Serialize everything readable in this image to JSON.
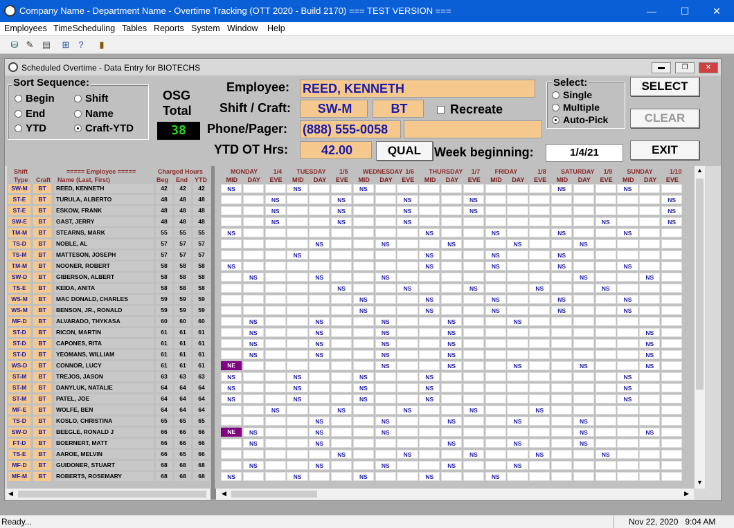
{
  "window": {
    "title": "Company Name - Department Name - Overtime Tracking (OTT 2020 - Build 2170) === TEST VERSION ===",
    "min": "—",
    "max": "☐",
    "close": "✕"
  },
  "menu": [
    "Employees",
    "TimeScheduling",
    "Tables",
    "Reports",
    "System",
    "Window",
    "Help"
  ],
  "toolbar_icons": [
    "database-icon",
    "pen-icon",
    "printer-icon",
    "grid-icon",
    "help-icon",
    "exit-door-icon"
  ],
  "child": {
    "title": "Scheduled Overtime - Data Entry for BIOTECHS"
  },
  "sort": {
    "label": "Sort Sequence:",
    "options": [
      {
        "label": "Begin",
        "selected": false
      },
      {
        "label": "Shift",
        "selected": false
      },
      {
        "label": "End",
        "selected": false
      },
      {
        "label": "Name",
        "selected": false
      },
      {
        "label": "YTD",
        "selected": false
      },
      {
        "label": "Craft-YTD",
        "selected": true
      }
    ]
  },
  "osg": {
    "label1": "OSG",
    "label2": "Total",
    "value": "38"
  },
  "employee": {
    "label": "Employee:",
    "value": "REED, KENNETH"
  },
  "shift_craft": {
    "label": "Shift / Craft:",
    "shift": "SW-M",
    "craft": "BT"
  },
  "recreate": {
    "label": "Recreate",
    "checked": false
  },
  "phone": {
    "label": "Phone/Pager:",
    "value": "(888) 555-0058",
    "value2": ""
  },
  "ytd": {
    "label": "YTD OT Hrs:",
    "value": "42.00"
  },
  "qual_button": "QUAL",
  "week": {
    "label": "Week beginning:",
    "value": "1/4/21"
  },
  "select": {
    "label": "Select:",
    "options": [
      {
        "label": "Single",
        "selected": false
      },
      {
        "label": "Multiple",
        "selected": false
      },
      {
        "label": "Auto-Pick",
        "selected": true
      }
    ]
  },
  "buttons": {
    "select": "SELECT",
    "clear": "CLEAR",
    "exit": "EXIT"
  },
  "grid_header": {
    "shift_type": "Shift\nType",
    "shift": "Shift",
    "type": "Type",
    "craft": "Craft",
    "employee": "===== Employee =====",
    "name": "Name (Last, First)",
    "charged": "Charged Hours",
    "beg": "Beg",
    "end": "End",
    "ytd": "YTD",
    "days": [
      {
        "day": "MONDAY",
        "date": "1/4"
      },
      {
        "day": "TUESDAY",
        "date": "1/5"
      },
      {
        "day": "WEDNESDAY",
        "date": "1/6"
      },
      {
        "day": "THURSDAY",
        "date": "1/7"
      },
      {
        "day": "FRIDAY",
        "date": "1/8"
      },
      {
        "day": "SATURDAY",
        "date": "1/9"
      },
      {
        "day": "SUNDAY",
        "date": "1/10"
      }
    ],
    "slots": [
      "MID",
      "DAY",
      "EVE"
    ]
  },
  "rows": [
    {
      "shift": "SW-M",
      "craft": "BT",
      "name": "REED, KENNETH",
      "beg": "42",
      "end": "42",
      "ytd": "42",
      "s": [
        "NS",
        "",
        "",
        "NS",
        "",
        "",
        "NS",
        "",
        "",
        "",
        "",
        "",
        "",
        "",
        "",
        "NS",
        "",
        "",
        "NS",
        "",
        ""
      ]
    },
    {
      "shift": "ST-E",
      "craft": "BT",
      "name": "TURULA, ALBERTO",
      "beg": "48",
      "end": "48",
      "ytd": "48",
      "s": [
        "",
        "",
        "NS",
        "",
        "",
        "NS",
        "",
        "",
        "NS",
        "",
        "",
        "NS",
        "",
        "",
        "",
        "",
        "",
        "",
        "",
        "",
        "NS"
      ]
    },
    {
      "shift": "ST-E",
      "craft": "BT",
      "name": "ESKOW, FRANK",
      "beg": "48",
      "end": "48",
      "ytd": "48",
      "s": [
        "",
        "",
        "NS",
        "",
        "",
        "NS",
        "",
        "",
        "NS",
        "",
        "",
        "NS",
        "",
        "",
        "",
        "",
        "",
        "",
        "",
        "",
        "NS"
      ]
    },
    {
      "shift": "SW-E",
      "craft": "BT",
      "name": "GAST, JERRY",
      "beg": "48",
      "end": "48",
      "ytd": "48",
      "s": [
        "",
        "",
        "NS",
        "",
        "",
        "NS",
        "",
        "",
        "NS",
        "",
        "",
        "",
        "",
        "",
        "",
        "",
        "",
        "NS",
        "",
        "",
        "NS"
      ]
    },
    {
      "shift": "TM-M",
      "craft": "BT",
      "name": "STEARNS, MARK",
      "beg": "55",
      "end": "55",
      "ytd": "55",
      "s": [
        "NS",
        "",
        "",
        "",
        "",
        "",
        "",
        "",
        "",
        "NS",
        "",
        "",
        "NS",
        "",
        "",
        "NS",
        "",
        "",
        "NS",
        "",
        ""
      ]
    },
    {
      "shift": "TS-D",
      "craft": "BT",
      "name": "NOBLE, AL",
      "beg": "57",
      "end": "57",
      "ytd": "57",
      "s": [
        "",
        "",
        "",
        "",
        "NS",
        "",
        "",
        "NS",
        "",
        "",
        "NS",
        "",
        "",
        "NS",
        "",
        "",
        "NS",
        "",
        "",
        "",
        ""
      ]
    },
    {
      "shift": "TS-M",
      "craft": "BT",
      "name": "MATTESON, JOSEPH",
      "beg": "57",
      "end": "57",
      "ytd": "57",
      "s": [
        "",
        "",
        "",
        "NS",
        "",
        "",
        "",
        "",
        "",
        "NS",
        "",
        "",
        "NS",
        "",
        "",
        "NS",
        "",
        "",
        "",
        "",
        ""
      ]
    },
    {
      "shift": "TM-M",
      "craft": "BT",
      "name": "NOONER, ROBERT",
      "beg": "58",
      "end": "58",
      "ytd": "58",
      "s": [
        "NS",
        "",
        "",
        "",
        "",
        "",
        "",
        "",
        "",
        "NS",
        "",
        "",
        "NS",
        "",
        "",
        "NS",
        "",
        "",
        "NS",
        "",
        ""
      ]
    },
    {
      "shift": "SW-D",
      "craft": "BT",
      "name": "GIBERSON, ALBERT",
      "beg": "58",
      "end": "58",
      "ytd": "58",
      "s": [
        "",
        "NS",
        "",
        "",
        "NS",
        "",
        "",
        "NS",
        "",
        "",
        "",
        "",
        "",
        "",
        "",
        "",
        "NS",
        "",
        "",
        "NS",
        ""
      ]
    },
    {
      "shift": "TS-E",
      "craft": "BT",
      "name": "KEIDA, ANITA",
      "beg": "58",
      "end": "58",
      "ytd": "58",
      "s": [
        "",
        "",
        "",
        "",
        "",
        "NS",
        "",
        "",
        "NS",
        "",
        "",
        "NS",
        "",
        "",
        "NS",
        "",
        "",
        "NS",
        "",
        "",
        ""
      ]
    },
    {
      "shift": "WS-M",
      "craft": "BT",
      "name": "MAC DONALD, CHARLES",
      "beg": "59",
      "end": "59",
      "ytd": "59",
      "s": [
        "",
        "",
        "",
        "",
        "",
        "",
        "NS",
        "",
        "",
        "NS",
        "",
        "",
        "NS",
        "",
        "",
        "NS",
        "",
        "",
        "NS",
        "",
        ""
      ]
    },
    {
      "shift": "WS-M",
      "craft": "BT",
      "name": "BENSON, JR., RONALD",
      "beg": "59",
      "end": "59",
      "ytd": "59",
      "s": [
        "",
        "",
        "",
        "",
        "",
        "",
        "NS",
        "",
        "",
        "NS",
        "",
        "",
        "NS",
        "",
        "",
        "NS",
        "",
        "",
        "NS",
        "",
        ""
      ]
    },
    {
      "shift": "MF-D",
      "craft": "BT",
      "name": "ALVARADO, THYKASA",
      "beg": "60",
      "end": "60",
      "ytd": "60",
      "s": [
        "",
        "NS",
        "",
        "",
        "NS",
        "",
        "",
        "NS",
        "",
        "",
        "NS",
        "",
        "",
        "NS",
        "",
        "",
        "",
        "",
        "",
        "",
        ""
      ]
    },
    {
      "shift": "ST-D",
      "craft": "BT",
      "name": "RICON, MARTIN",
      "beg": "61",
      "end": "61",
      "ytd": "61",
      "s": [
        "",
        "NS",
        "",
        "",
        "NS",
        "",
        "",
        "NS",
        "",
        "",
        "NS",
        "",
        "",
        "",
        "",
        "",
        "",
        "",
        "",
        "NS",
        ""
      ]
    },
    {
      "shift": "ST-D",
      "craft": "BT",
      "name": "CAPONES, RITA",
      "beg": "61",
      "end": "61",
      "ytd": "61",
      "s": [
        "",
        "NS",
        "",
        "",
        "NS",
        "",
        "",
        "NS",
        "",
        "",
        "NS",
        "",
        "",
        "",
        "",
        "",
        "",
        "",
        "",
        "NS",
        ""
      ]
    },
    {
      "shift": "ST-D",
      "craft": "BT",
      "name": "YEOMANS, WILLIAM",
      "beg": "61",
      "end": "61",
      "ytd": "61",
      "s": [
        "",
        "NS",
        "",
        "",
        "NS",
        "",
        "",
        "NS",
        "",
        "",
        "NS",
        "",
        "",
        "",
        "",
        "",
        "",
        "",
        "",
        "NS",
        ""
      ]
    },
    {
      "shift": "WS-D",
      "craft": "BT",
      "name": "CONNOR, LUCY",
      "beg": "61",
      "end": "61",
      "ytd": "61",
      "s": [
        "NE",
        "",
        "",
        "",
        "",
        "",
        "",
        "NS",
        "",
        "",
        "NS",
        "",
        "",
        "NS",
        "",
        "",
        "NS",
        "",
        "",
        "NS",
        ""
      ]
    },
    {
      "shift": "ST-M",
      "craft": "BT",
      "name": "TREJOS, JASON",
      "beg": "63",
      "end": "63",
      "ytd": "63",
      "s": [
        "NS",
        "",
        "",
        "NS",
        "",
        "",
        "NS",
        "",
        "",
        "NS",
        "",
        "",
        "",
        "",
        "",
        "",
        "",
        "",
        "NS",
        "",
        ""
      ]
    },
    {
      "shift": "ST-M",
      "craft": "BT",
      "name": "DANYLUK, NATALIE",
      "beg": "64",
      "end": "64",
      "ytd": "64",
      "s": [
        "NS",
        "",
        "",
        "NS",
        "",
        "",
        "NS",
        "",
        "",
        "NS",
        "",
        "",
        "",
        "",
        "",
        "",
        "",
        "",
        "NS",
        "",
        ""
      ]
    },
    {
      "shift": "ST-M",
      "craft": "BT",
      "name": "PATEL, JOE",
      "beg": "64",
      "end": "64",
      "ytd": "64",
      "s": [
        "NS",
        "",
        "",
        "NS",
        "",
        "",
        "NS",
        "",
        "",
        "NS",
        "",
        "",
        "",
        "",
        "",
        "",
        "",
        "",
        "NS",
        "",
        ""
      ]
    },
    {
      "shift": "MF-E",
      "craft": "BT",
      "name": "WOLFE, BEN",
      "beg": "64",
      "end": "64",
      "ytd": "64",
      "s": [
        "",
        "",
        "NS",
        "",
        "",
        "NS",
        "",
        "",
        "NS",
        "",
        "",
        "NS",
        "",
        "",
        "NS",
        "",
        "",
        "",
        "",
        "",
        ""
      ]
    },
    {
      "shift": "TS-D",
      "craft": "BT",
      "name": "KOSLO, CHRISTINA",
      "beg": "65",
      "end": "65",
      "ytd": "65",
      "s": [
        "",
        "",
        "",
        "",
        "NS",
        "",
        "",
        "NS",
        "",
        "",
        "NS",
        "",
        "",
        "NS",
        "",
        "",
        "NS",
        "",
        "",
        "",
        ""
      ]
    },
    {
      "shift": "SW-D",
      "craft": "BT",
      "name": "BEEGLE, RONALD J",
      "beg": "66",
      "end": "66",
      "ytd": "66",
      "s": [
        "NE",
        "NS",
        "",
        "",
        "NS",
        "",
        "",
        "NS",
        "",
        "",
        "",
        "",
        "",
        "",
        "",
        "",
        "NS",
        "",
        "",
        "NS",
        ""
      ]
    },
    {
      "shift": "FT-D",
      "craft": "BT",
      "name": "BOERNERT, MATT",
      "beg": "66",
      "end": "66",
      "ytd": "66",
      "s": [
        "",
        "NS",
        "",
        "",
        "NS",
        "",
        "",
        "",
        "",
        "",
        "NS",
        "",
        "",
        "NS",
        "",
        "",
        "NS",
        "",
        "",
        "",
        ""
      ]
    },
    {
      "shift": "TS-E",
      "craft": "BT",
      "name": "AAROE, MELVIN",
      "beg": "66",
      "end": "65",
      "ytd": "66",
      "s": [
        "",
        "",
        "",
        "",
        "",
        "NS",
        "",
        "",
        "NS",
        "",
        "",
        "NS",
        "",
        "",
        "NS",
        "",
        "",
        "NS",
        "",
        "",
        ""
      ]
    },
    {
      "shift": "MF-D",
      "craft": "BT",
      "name": "GUIDONER, STUART",
      "beg": "68",
      "end": "68",
      "ytd": "68",
      "s": [
        "",
        "NS",
        "",
        "",
        "NS",
        "",
        "",
        "NS",
        "",
        "",
        "NS",
        "",
        "",
        "NS",
        "",
        "",
        "",
        "",
        "",
        "",
        ""
      ]
    },
    {
      "shift": "MF-M",
      "craft": "BT",
      "name": "ROBERTS, ROSEMARY",
      "beg": "68",
      "end": "68",
      "ytd": "68",
      "s": [
        "NS",
        "",
        "",
        "NS",
        "",
        "",
        "NS",
        "",
        "",
        "NS",
        "",
        "",
        "NS",
        "",
        "",
        "",
        "",
        "",
        "",
        "",
        ""
      ]
    }
  ],
  "status": {
    "text": "Ready...",
    "datetime": "Nov 22, 2020   9:04 AM"
  }
}
